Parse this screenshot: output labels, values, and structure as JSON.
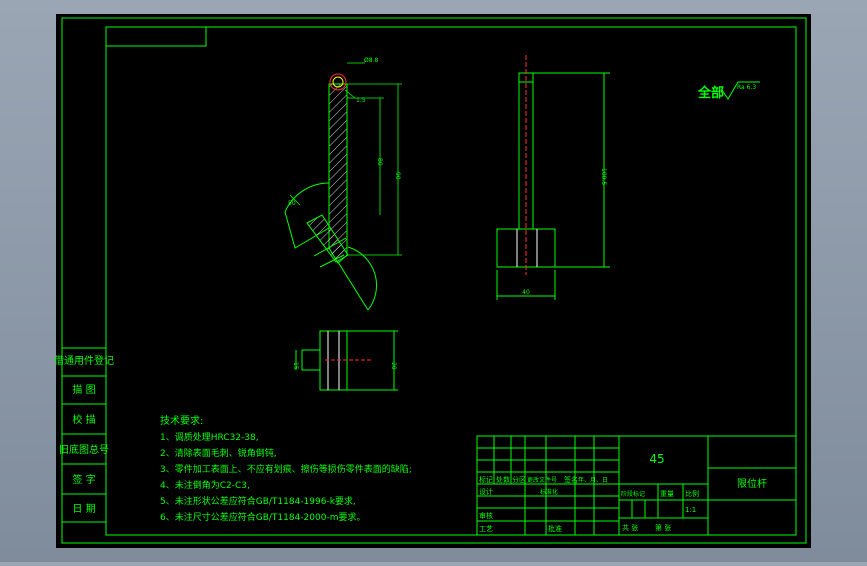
{
  "drawing": {
    "background_color": "#000000",
    "line_color": "#00ff00",
    "hatch_color": "#ffffff",
    "centerline_color": "#ff3030",
    "dim_color": "#ffff00"
  },
  "left_column": {
    "items": [
      "借通用件登记",
      "描 图",
      "校 描",
      "旧底图总号",
      "签 字",
      "日 期"
    ]
  },
  "technical_requirements": {
    "title": "技术要求:",
    "items": [
      "1、调质处理HRC32-38,",
      "2、清除表面毛刺、锐角倒钝,",
      "3、零件加工表面上、不应有划痕、擦伤等损伤零件表面的缺陷;",
      "4、未注倒角为C2-C3,",
      "5、未注形状公差应符合GB/T1184-1996-k要求,",
      "6、未注尺寸公差应符合GB/T1184-2000-m要求。"
    ]
  },
  "surface_finish": {
    "label": "全部",
    "value": "Ra 6.3"
  },
  "dimensions": {
    "top_dia": "Ø8.8",
    "angle": "1.5",
    "length_short": "80",
    "length_long": "90",
    "arc_dim": "50",
    "front_height": "100.5",
    "front_width": "40",
    "small_width": "15",
    "small_height": "20"
  },
  "title_block": {
    "material": "45",
    "part_name": "限位杆",
    "scale": "1:1",
    "row_header": [
      "标记",
      "处数",
      "分区",
      "更改文件号",
      "签名",
      "年、月、日"
    ],
    "designer_row": [
      "设计",
      "",
      "标准化"
    ],
    "stage_header": [
      "阶段标记",
      "重量",
      "比例"
    ],
    "review_label": "审核",
    "process_label": "工艺",
    "approve_label": "批准",
    "sheet_total": "共 张",
    "sheet_num": "第 张"
  }
}
